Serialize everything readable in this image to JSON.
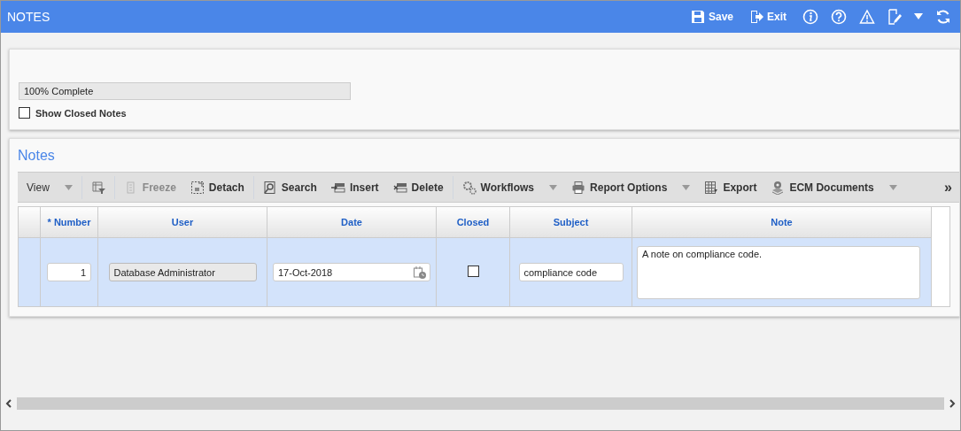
{
  "header": {
    "title": "NOTES",
    "actions": [
      {
        "label": "Save"
      },
      {
        "label": "Exit"
      }
    ]
  },
  "progress": {
    "label": "100% Complete",
    "level": 1
  },
  "show_closed": {
    "label": "Show Closed Notes",
    "checked": false
  },
  "notes": {
    "title": "Notes",
    "toolbar": [
      {
        "kind": "dropdown",
        "label": "View",
        "disabled": false
      },
      {
        "kind": "icon",
        "disabled": false
      },
      {
        "kind": "button",
        "label": "Freeze",
        "disabled": true
      },
      {
        "kind": "button",
        "label": "Detach",
        "disabled": false
      },
      {
        "kind": "button",
        "label": "Search",
        "disabled": false
      },
      {
        "kind": "button",
        "label": "Insert",
        "disabled": false
      },
      {
        "kind": "button",
        "label": "Delete",
        "disabled": false
      },
      {
        "kind": "dropdown",
        "label": "Workflows",
        "disabled": false
      },
      {
        "kind": "dropdown",
        "label": "Report Options",
        "disabled": false
      },
      {
        "kind": "button",
        "label": "Export",
        "disabled": false
      },
      {
        "kind": "dropdown",
        "label": "ECM Documents",
        "disabled": false
      },
      {
        "kind": "more",
        "label": "»",
        "disabled": false
      }
    ],
    "columns": [
      "* Number",
      "User",
      "Date",
      "Closed",
      "Subject",
      "Note"
    ],
    "rows": [
      {
        "selected": true,
        "number": "1",
        "user": "Database Administrator",
        "date": "17-Oct-2018",
        "closed": false,
        "subject": "compliance code",
        "note": "A note on compliance code."
      }
    ]
  }
}
